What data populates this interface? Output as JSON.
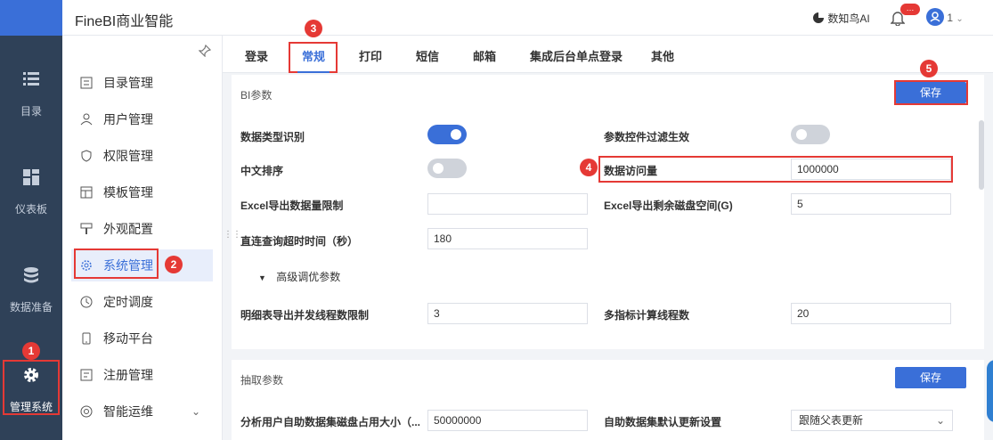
{
  "app": {
    "brand": "FineBI商业智能"
  },
  "header": {
    "ai_label": "数知鸟AI",
    "bell_badge": "…",
    "user_label": "1"
  },
  "rail": [
    {
      "key": "catalog",
      "label": "目录"
    },
    {
      "key": "dashboard",
      "label": "仪表板"
    },
    {
      "key": "data",
      "label": "数据准备"
    },
    {
      "key": "admin",
      "label": "管理系统"
    }
  ],
  "sidebar": {
    "items": [
      {
        "label": "目录管理"
      },
      {
        "label": "用户管理"
      },
      {
        "label": "权限管理"
      },
      {
        "label": "模板管理"
      },
      {
        "label": "外观配置"
      },
      {
        "label": "系统管理"
      },
      {
        "label": "定时调度"
      },
      {
        "label": "移动平台"
      },
      {
        "label": "注册管理"
      },
      {
        "label": "智能运维"
      }
    ]
  },
  "tabs": [
    "登录",
    "常规",
    "打印",
    "短信",
    "邮箱",
    "集成后台单点登录",
    "其他"
  ],
  "bi_params": {
    "title": "BI参数",
    "save": "保存",
    "fields": {
      "data_type_label": "数据类型识别",
      "param_filter_label": "参数控件过滤生效",
      "cn_sort_label": "中文排序",
      "data_access_label": "数据访问量",
      "data_access_value": "1000000",
      "excel_limit_label": "Excel导出数据量限制",
      "excel_limit_value": "",
      "excel_disk_label": "Excel导出剩余磁盘空间(G)",
      "excel_disk_value": "5",
      "direct_timeout_label": "直连查询超时时间（秒）",
      "direct_timeout_value": "180",
      "advanced_label": "高级调优参数",
      "detail_threads_label": "明细表导出并发线程数限制",
      "detail_threads_value": "3",
      "multi_metric_label": "多指标计算线程数",
      "multi_metric_value": "20"
    },
    "toggles": {
      "data_type": true,
      "param_filter": false,
      "cn_sort": false
    }
  },
  "extract_params": {
    "title": "抽取参数",
    "save": "保存",
    "disk_label": "分析用户自助数据集磁盘占用大小（...",
    "disk_value": "50000000",
    "update_label": "自助数据集默认更新设置",
    "update_value": "跟随父表更新"
  },
  "markers": [
    "1",
    "2",
    "3",
    "4",
    "5"
  ],
  "colors": {
    "accent": "#3a6fd8",
    "rail": "#2f4158",
    "highlight": "#e53935"
  }
}
